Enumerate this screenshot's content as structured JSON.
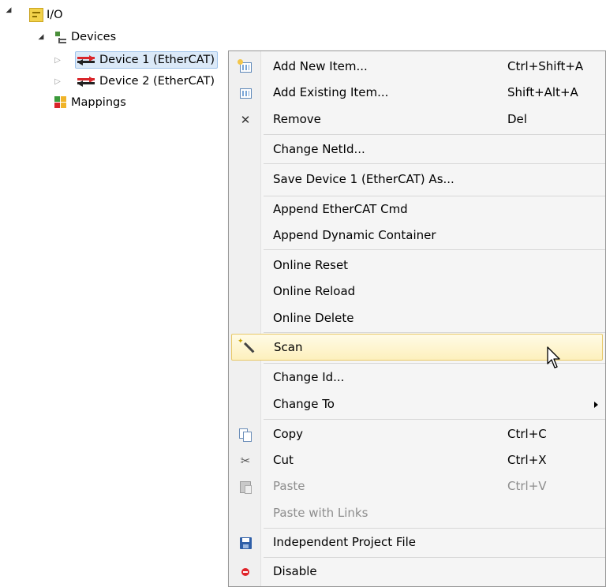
{
  "tree": {
    "io_label": "I/O",
    "devices_label": "Devices",
    "device1_label": "Device 1 (EtherCAT)",
    "device2_label": "Device 2 (EtherCAT)",
    "mappings_label": "Mappings"
  },
  "menu": {
    "items": [
      {
        "label": "Add New Item...",
        "shortcut": "Ctrl+Shift+A",
        "icon": "add-new-item-icon",
        "enabled": true
      },
      {
        "label": "Add Existing Item...",
        "shortcut": "Shift+Alt+A",
        "icon": "add-existing-item-icon",
        "enabled": true
      },
      {
        "label": "Remove",
        "shortcut": "Del",
        "icon": "remove-icon",
        "enabled": true
      },
      {
        "label": "Change NetId...",
        "shortcut": "",
        "enabled": true
      },
      {
        "label": "Save Device 1 (EtherCAT) As...",
        "shortcut": "",
        "enabled": true
      },
      {
        "label": "Append EtherCAT Cmd",
        "shortcut": "",
        "enabled": true
      },
      {
        "label": "Append Dynamic Container",
        "shortcut": "",
        "enabled": true
      },
      {
        "label": "Online Reset",
        "shortcut": "",
        "enabled": true
      },
      {
        "label": "Online Reload",
        "shortcut": "",
        "enabled": true
      },
      {
        "label": "Online Delete",
        "shortcut": "",
        "enabled": true
      },
      {
        "label": "Scan",
        "shortcut": "",
        "icon": "scan-wand-icon",
        "enabled": true,
        "highlighted": true
      },
      {
        "label": "Change Id...",
        "shortcut": "",
        "enabled": true
      },
      {
        "label": "Change To",
        "shortcut": "",
        "enabled": true,
        "submenu": true
      },
      {
        "label": "Copy",
        "shortcut": "Ctrl+C",
        "icon": "copy-icon",
        "enabled": true
      },
      {
        "label": "Cut",
        "shortcut": "Ctrl+X",
        "icon": "cut-icon",
        "enabled": true
      },
      {
        "label": "Paste",
        "shortcut": "Ctrl+V",
        "icon": "paste-icon",
        "enabled": false
      },
      {
        "label": "Paste with Links",
        "shortcut": "",
        "enabled": false
      },
      {
        "label": "Independent Project File",
        "shortcut": "",
        "icon": "save-icon",
        "enabled": true
      },
      {
        "label": "Disable",
        "shortcut": "",
        "icon": "disable-icon",
        "enabled": true
      }
    ]
  },
  "colors": {
    "highlight": "#fdf0bd",
    "selection": "#dbe9f8",
    "disabled_text": "#8d8d8d"
  }
}
